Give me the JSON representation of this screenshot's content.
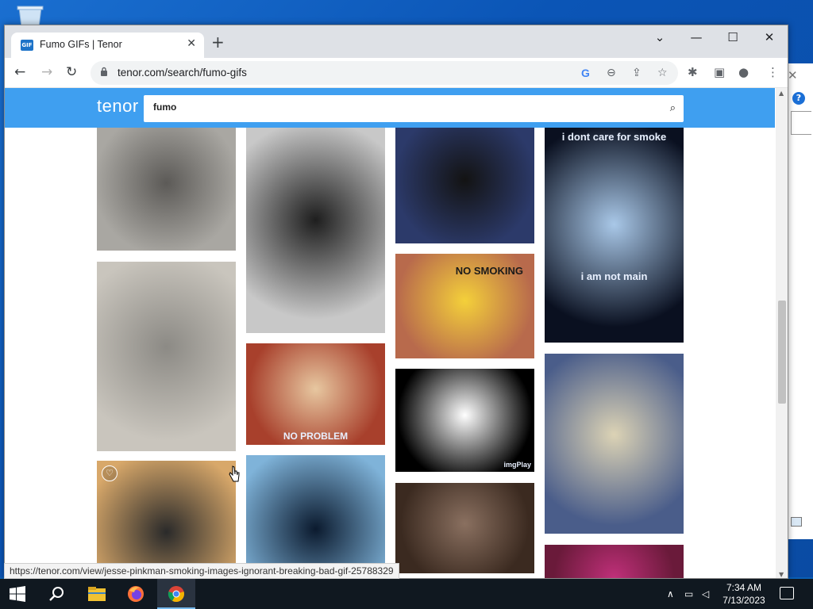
{
  "browser": {
    "tab_title": "Fumo GIFs | Tenor",
    "favicon_text": "GIF",
    "url": "tenor.com/search/fumo-gifs",
    "new_tab_label": "+",
    "status_url": "https://tenor.com/view/jesse-pinkman-smoking-images-ignorant-breaking-bad-gif-25788329"
  },
  "tenor": {
    "logo": "tenor",
    "search_value": "fumo"
  },
  "gifs": [
    {
      "col": 0,
      "colors": [
        "#a9a7a2",
        "#5c5a57"
      ],
      "tags": "",
      "overlay": ""
    },
    {
      "col": 0,
      "colors": [
        "#c9c5bd",
        "#8c8a85"
      ],
      "tags": "",
      "overlay": ""
    },
    {
      "col": 0,
      "colors": [
        "#d8a86a",
        "#2a2a2a"
      ],
      "tags": "#jesse  #pinkman",
      "overlay": ""
    },
    {
      "col": 1,
      "colors": [
        "#c8c8c8",
        "#1e1e1e"
      ],
      "tags": "",
      "overlay": ""
    },
    {
      "col": 1,
      "colors": [
        "#a8402c",
        "#e7c7a0"
      ],
      "tags": "",
      "overlay": "NO PROBLEM"
    },
    {
      "col": 1,
      "colors": [
        "#7fb3d9",
        "#0b1a2e"
      ],
      "tags": "",
      "overlay": ""
    },
    {
      "col": 2,
      "colors": [
        "#2c3a6a",
        "#131313"
      ],
      "tags": "",
      "overlay": ""
    },
    {
      "col": 2,
      "colors": [
        "#b86a4c",
        "#f4d03a"
      ],
      "tags": "",
      "overlay": "NO SMOKING"
    },
    {
      "col": 2,
      "colors": [
        "#000000",
        "#ffffff"
      ],
      "tags": "",
      "overlay": "imgPlay"
    },
    {
      "col": 2,
      "colors": [
        "#3b2a20",
        "#8a7060"
      ],
      "tags": "",
      "overlay": ""
    },
    {
      "col": 2,
      "colors": [
        "#d0ccc4",
        "#aaa49c"
      ],
      "tags": "",
      "overlay": ""
    },
    {
      "col": 3,
      "colors": [
        "#0a1020",
        "#a9c8e8"
      ],
      "tags": "",
      "overlay": "i dont care for smoke",
      "overlay2": "i am not main"
    },
    {
      "col": 3,
      "colors": [
        "#4a5d8a",
        "#dcd3b5"
      ],
      "tags": "",
      "overlay": ""
    },
    {
      "col": 3,
      "colors": [
        "#6a1a3a",
        "#c0307a"
      ],
      "tags": "",
      "overlay": ""
    }
  ],
  "taskbar": {
    "time": "7:34 AM",
    "date": "7/13/2023"
  }
}
